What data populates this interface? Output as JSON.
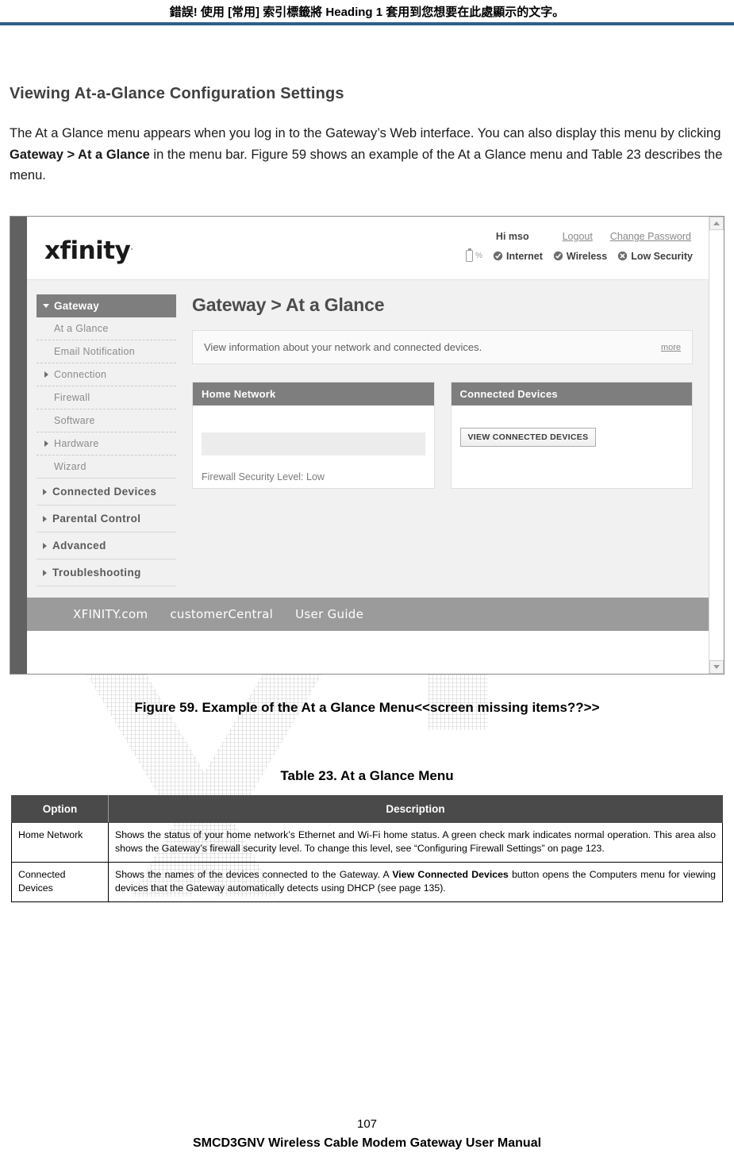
{
  "doc": {
    "running_header": "錯誤! 使用 [常用] 索引標籤將 Heading 1 套用到您想要在此處顯示的文字。",
    "header_rule_color": "#2e5f8a",
    "page_number": "107",
    "footer": "SMCD3GNV Wireless Cable Modem Gateway User Manual"
  },
  "section": {
    "title": "Viewing At-a-Glance Configuration Settings",
    "paragraph_1": "The At a Glance menu appears when you log in to the Gateway’s Web interface. You can also display this menu by clicking ",
    "paragraph_bold": "Gateway > At a Glance",
    "paragraph_2": " in the menu bar. Figure 59 shows an example of the At a Glance menu and Table 23 describes the menu."
  },
  "screenshot": {
    "brand": "xfinity",
    "brand_tm": ".",
    "account": {
      "greeting": "Hi mso",
      "logout": "Logout",
      "change_password": "Change Password"
    },
    "status": {
      "battery_pct": "%",
      "internet": "Internet",
      "wireless": "Wireless",
      "security": "Low Security"
    },
    "sidebar": {
      "header": "Gateway",
      "items": [
        {
          "label": "At a Glance",
          "type": "sub",
          "caret": false
        },
        {
          "label": "Email Notification",
          "type": "sub",
          "caret": false
        },
        {
          "label": "Connection",
          "type": "sub",
          "caret": true
        },
        {
          "label": "Firewall",
          "type": "sub",
          "caret": false
        },
        {
          "label": "Software",
          "type": "sub",
          "caret": false
        },
        {
          "label": "Hardware",
          "type": "sub",
          "caret": true
        },
        {
          "label": "Wizard",
          "type": "sub",
          "caret": false
        },
        {
          "label": "Connected Devices",
          "type": "top",
          "caret": true
        },
        {
          "label": "Parental Control",
          "type": "top",
          "caret": true
        },
        {
          "label": "Advanced",
          "type": "top",
          "caret": true
        },
        {
          "label": "Troubleshooting",
          "type": "top",
          "caret": true
        }
      ]
    },
    "main": {
      "title": "Gateway > At a Glance",
      "info_text": "View information about your network and connected devices.",
      "info_more": "more",
      "panel_home": {
        "header": "Home Network",
        "firewall_label": "Firewall Security Level:",
        "firewall_value": "Low"
      },
      "panel_devices": {
        "header": "Connected Devices",
        "button": "VIEW CONNECTED DEVICES"
      }
    },
    "footer_links": [
      "XFINITY.com",
      "customerCentral",
      "User Guide"
    ],
    "colors": {
      "panel_header": "#7e7e7e",
      "page_bg": "#f1f1f1",
      "footer_bar": "#9b9b9b",
      "left_margin_bar": "#616161"
    }
  },
  "figure": {
    "caption": "Figure 59. Example of the At a Glance Menu<<screen missing items??>>"
  },
  "table": {
    "caption": "Table 23. At a Glance Menu",
    "headers": [
      "Option",
      "Description"
    ],
    "rows": [
      {
        "option": "Home Network",
        "desc_1": "Shows the status of your home network’s Ethernet and Wi-Fi home status. A green check mark indicates normal operation. This area also shows the Gateway’s firewall security level. To change this level, see “Configuring Firewall Settings” on page 123.",
        "desc_bold": "",
        "desc_2": ""
      },
      {
        "option": "Connected Devices",
        "desc_1": "Shows the names of the devices connected to the Gateway. A ",
        "desc_bold": "View Connected Devices",
        "desc_2": " button opens the Computers menu for viewing devices that the Gateway automatically detects using DHCP (see page 135)."
      }
    ]
  }
}
